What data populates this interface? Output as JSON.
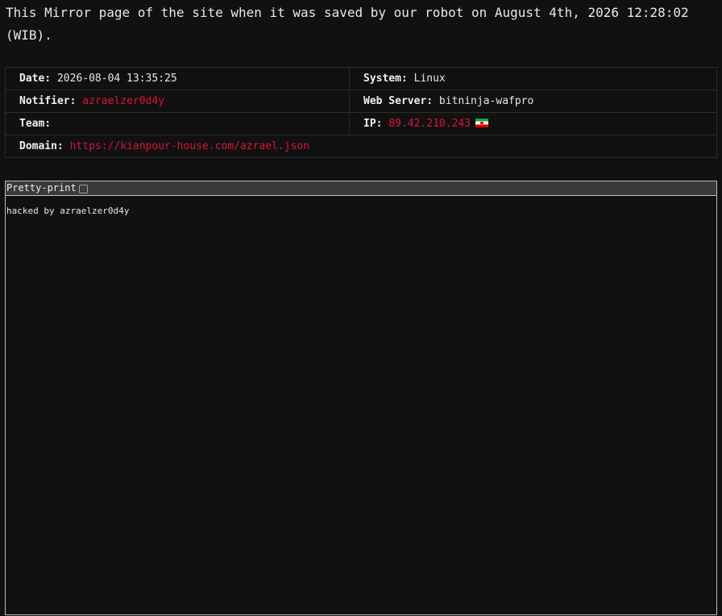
{
  "header": {
    "message": "This Mirror page of the site when it was saved by our robot on August 4th, 2026 12:28:02 (WIB)."
  },
  "info": {
    "date_label": "Date:",
    "date_value": "2026-08-04 13:35:25",
    "system_label": "System:",
    "system_value": "Linux",
    "notifier_label": "Notifier:",
    "notifier_value": "azraelzer0d4y",
    "webserver_label": "Web Server:",
    "webserver_value": "bitninja-wafpro",
    "team_label": "Team:",
    "team_value": "",
    "ip_label": "IP:",
    "ip_value": "89.42.210.243",
    "ip_flag_icon": "iran-flag-icon",
    "domain_label": "Domain:",
    "domain_value": "https://kianpour-house.com/azrael.json"
  },
  "viewer": {
    "toolbar_label": "Pretty-print",
    "pretty_print_checked": false,
    "content": "hacked by azraelzer0d4y"
  },
  "colors": {
    "background": "#111111",
    "accent_red": "#d7143c",
    "toolbar_bg": "#3a3a3a"
  }
}
